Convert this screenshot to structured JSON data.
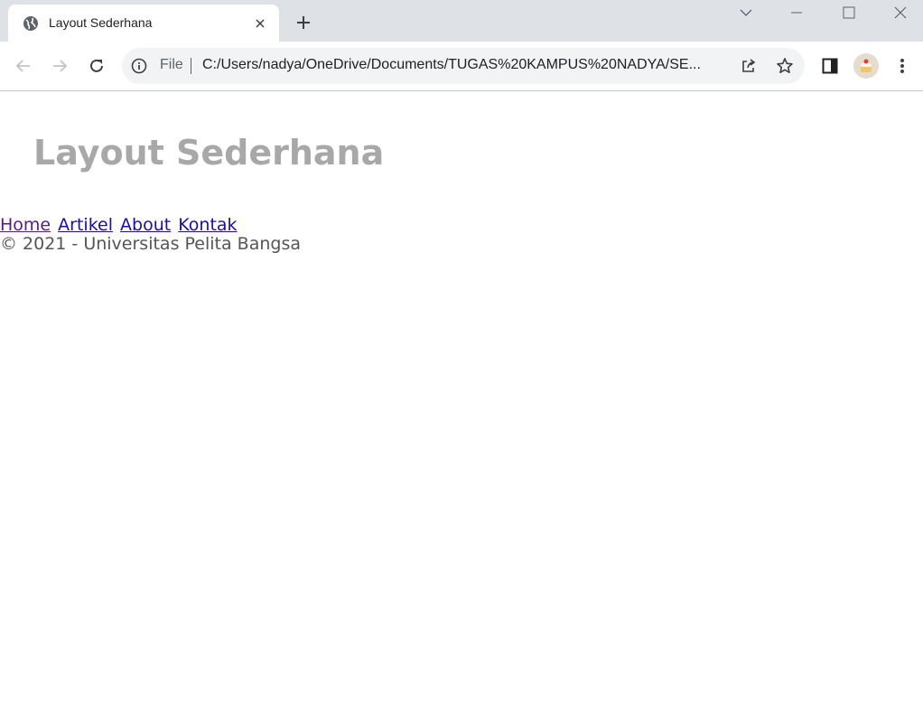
{
  "browser": {
    "tab": {
      "title": "Layout Sederhana",
      "favicon": "globe-icon"
    },
    "new_tab_icon": "plus-icon",
    "window_controls": [
      "chevron-down-icon",
      "minimize-icon",
      "maximize-icon",
      "close-icon"
    ],
    "toolbar": {
      "back_icon": "back-arrow-icon",
      "forward_icon": "forward-arrow-icon",
      "reload_icon": "reload-icon",
      "omnibox": {
        "scheme_label": "File",
        "url": "C:/Users/nadya/OneDrive/Documents/TUGAS%20KAMPUS%20NADYA/SE..."
      },
      "share_icon": "share-icon",
      "bookmark_icon": "star-icon",
      "sidepanel_icon": "side-panel-icon",
      "menu_icon": "kebab-menu-icon"
    }
  },
  "page": {
    "heading": "Layout Sederhana",
    "nav": [
      {
        "label": "Home"
      },
      {
        "label": "Artikel"
      },
      {
        "label": "About"
      },
      {
        "label": "Kontak"
      }
    ],
    "footer": "© 2021 - Universitas Pelita Bangsa"
  },
  "colors": {
    "tabstrip_bg": "#dee1e6",
    "heading": "#a8a8a8",
    "link": "#1a0dab",
    "visited_link": "#551a8b",
    "footer_text": "#555555"
  }
}
